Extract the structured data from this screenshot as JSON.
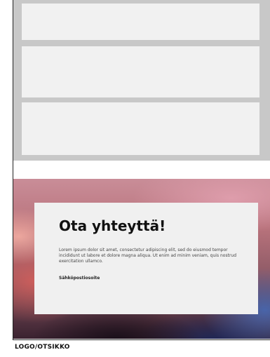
{
  "contact": {
    "title": "Ota yhteyttä!",
    "body": "Lorem ipsum dolor sit amet, consectetur adipiscing elit, sed do eiusmod tempor incididunt ut labore et dolore magna aliqua. Ut enim ad minim veniam, quis nostrud exercitation ullamco.",
    "email_label": "Sähköpostiosoite"
  },
  "footer": {
    "logo_text": "LOGO/OTSIKKO"
  },
  "colors": {
    "gray_band": "#c8c8c8",
    "card": "#f1f1f1",
    "contact_card": "#f0f0f0",
    "text_dark": "#111111"
  }
}
